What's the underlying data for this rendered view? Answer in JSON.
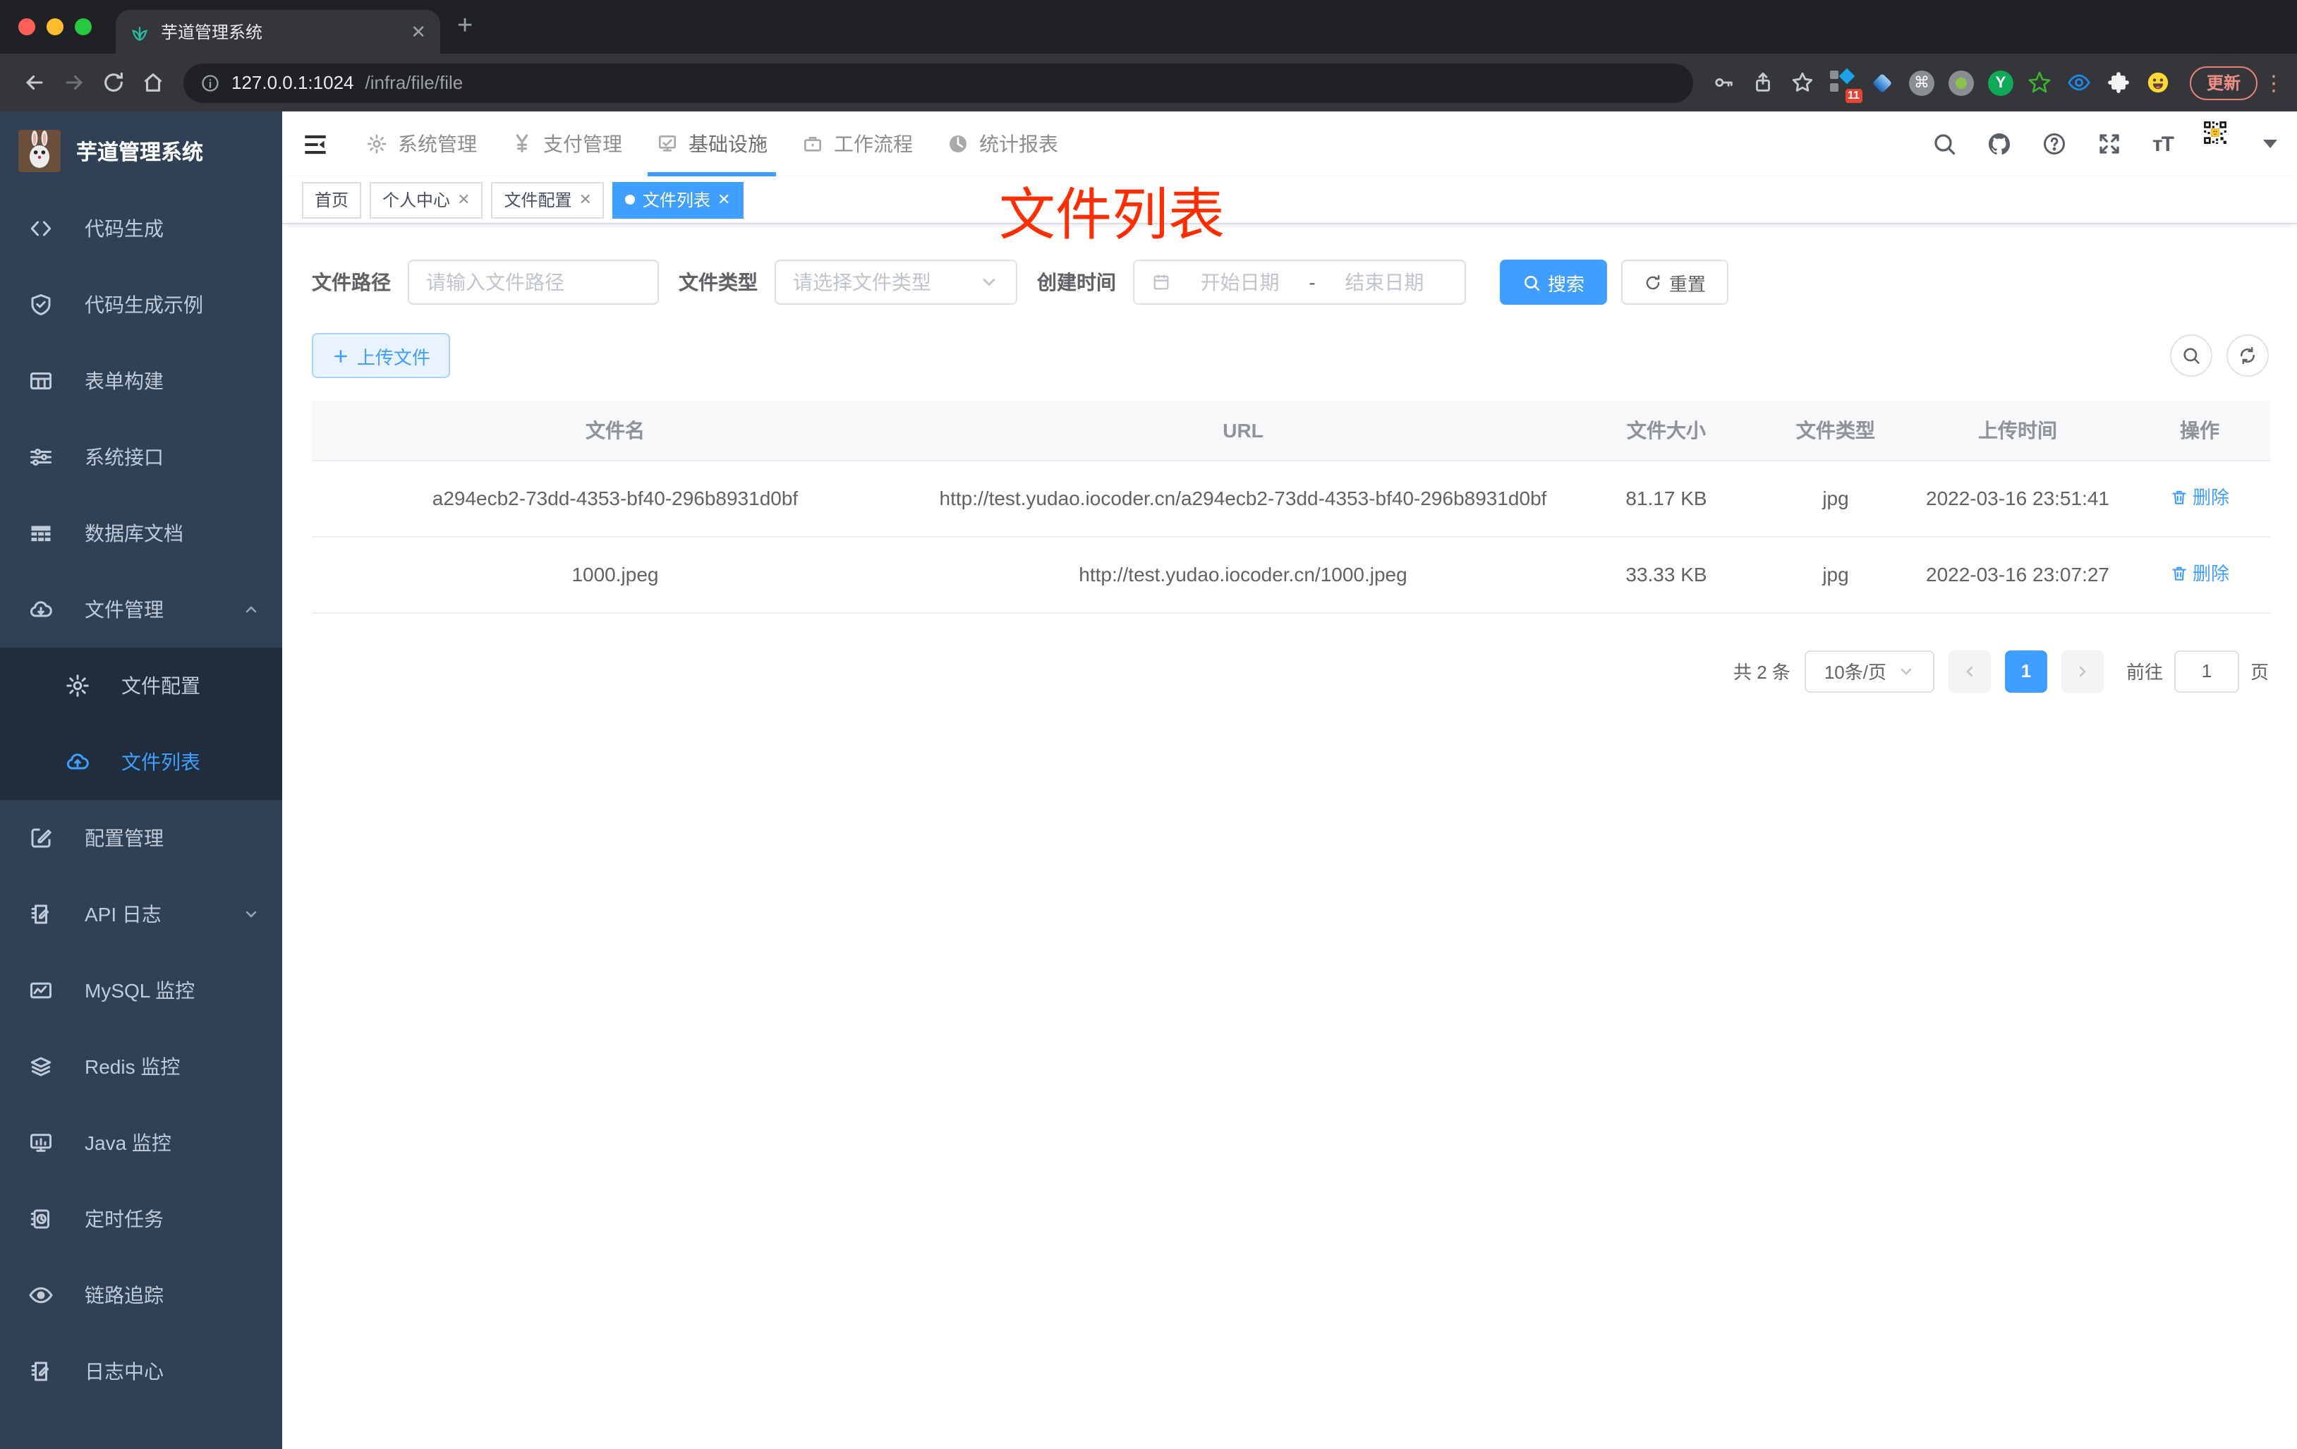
{
  "browser": {
    "tab_title": "芋道管理系统",
    "url_host": "127.0.0.1:1024",
    "url_path": "/infra/file/file",
    "extensions_badge": "11",
    "update_label": "更新"
  },
  "app_header": {
    "title": "芋道管理系统",
    "menu": [
      {
        "label": "系统管理"
      },
      {
        "label": "支付管理"
      },
      {
        "label": "基础设施"
      },
      {
        "label": "工作流程"
      },
      {
        "label": "统计报表"
      }
    ],
    "active_menu": "基础设施"
  },
  "sidebar": {
    "items": [
      {
        "label": "代码生成"
      },
      {
        "label": "代码生成示例"
      },
      {
        "label": "表单构建"
      },
      {
        "label": "系统接口"
      },
      {
        "label": "数据库文档"
      },
      {
        "label": "文件管理"
      },
      {
        "label": "文件配置"
      },
      {
        "label": "文件列表"
      },
      {
        "label": "配置管理"
      },
      {
        "label": "API 日志"
      },
      {
        "label": "MySQL 监控"
      },
      {
        "label": "Redis 监控"
      },
      {
        "label": "Java 监控"
      },
      {
        "label": "定时任务"
      },
      {
        "label": "链路追踪"
      },
      {
        "label": "日志中心"
      }
    ],
    "active_item": "文件列表"
  },
  "tags": {
    "items": [
      {
        "label": "首页"
      },
      {
        "label": "个人中心"
      },
      {
        "label": "文件配置"
      },
      {
        "label": "文件列表"
      }
    ],
    "active": "文件列表"
  },
  "annotation": {
    "text": "文件列表",
    "color": "#ff2d00"
  },
  "filters": {
    "path_label": "文件路径",
    "path_placeholder": "请输入文件路径",
    "type_label": "文件类型",
    "type_placeholder": "请选择文件类型",
    "date_label": "创建时间",
    "date_start": "开始日期",
    "date_separator": "-",
    "date_end": "结束日期",
    "search_label": "搜索",
    "reset_label": "重置"
  },
  "toolbar": {
    "upload_label": "上传文件"
  },
  "table": {
    "headers": [
      "文件名",
      "URL",
      "文件大小",
      "文件类型",
      "上传时间",
      "操作"
    ],
    "rows": [
      {
        "name": "a294ecb2-73dd-4353-bf40-296b8931d0bf",
        "url": "http://test.yudao.iocoder.cn/a294ecb2-73dd-4353-bf40-296b8931d0bf",
        "size": "81.17 KB",
        "type": "jpg",
        "time": "2022-03-16 23:51:41",
        "action": "删除"
      },
      {
        "name": "1000.jpeg",
        "url": "http://test.yudao.iocoder.cn/1000.jpeg",
        "size": "33.33 KB",
        "type": "jpg",
        "time": "2022-03-16 23:07:27",
        "action": "删除"
      }
    ]
  },
  "pagination": {
    "total": "共 2 条",
    "page_size": "10条/页",
    "current_page": "1",
    "goto_label": "前往",
    "goto_value": "1",
    "page_unit": "页"
  },
  "colors": {
    "accent": "#409eff",
    "sidebar_bg": "#304156",
    "submenu_bg": "#1f2d3d",
    "annotation": "#ff2d00",
    "header_active_underline": "#409eff"
  }
}
